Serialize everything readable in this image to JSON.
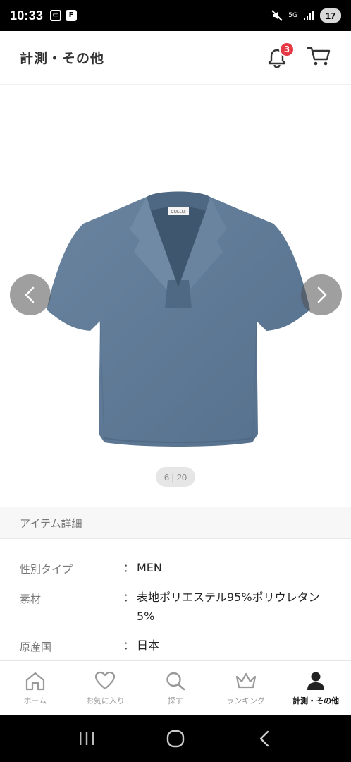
{
  "status_bar": {
    "time": "10:33",
    "signal_label": "5G",
    "battery": "17"
  },
  "header": {
    "title": "計測・その他",
    "notification_count": "3"
  },
  "gallery": {
    "counter": "6 | 20",
    "brand_tag": "CULLNI",
    "shirt_color": "#5d7892"
  },
  "section": {
    "title": "アイテム詳細"
  },
  "details": [
    {
      "label": "性別タイプ",
      "colon": "：",
      "value": "MEN"
    },
    {
      "label": "素材",
      "colon": "：",
      "value": "表地ポリエステル95%ポリウレタン5%"
    },
    {
      "label": "原産国",
      "colon": "：",
      "value": "日本"
    }
  ],
  "tabs": [
    {
      "label": "ホーム",
      "icon": "home-icon"
    },
    {
      "label": "お気に入り",
      "icon": "heart-icon"
    },
    {
      "label": "探す",
      "icon": "search-icon"
    },
    {
      "label": "ランキング",
      "icon": "crown-icon"
    },
    {
      "label": "計測・その他",
      "icon": "person-icon",
      "active": true
    }
  ],
  "colors": {
    "badge": "#e53945",
    "accent_text": "#111111"
  }
}
